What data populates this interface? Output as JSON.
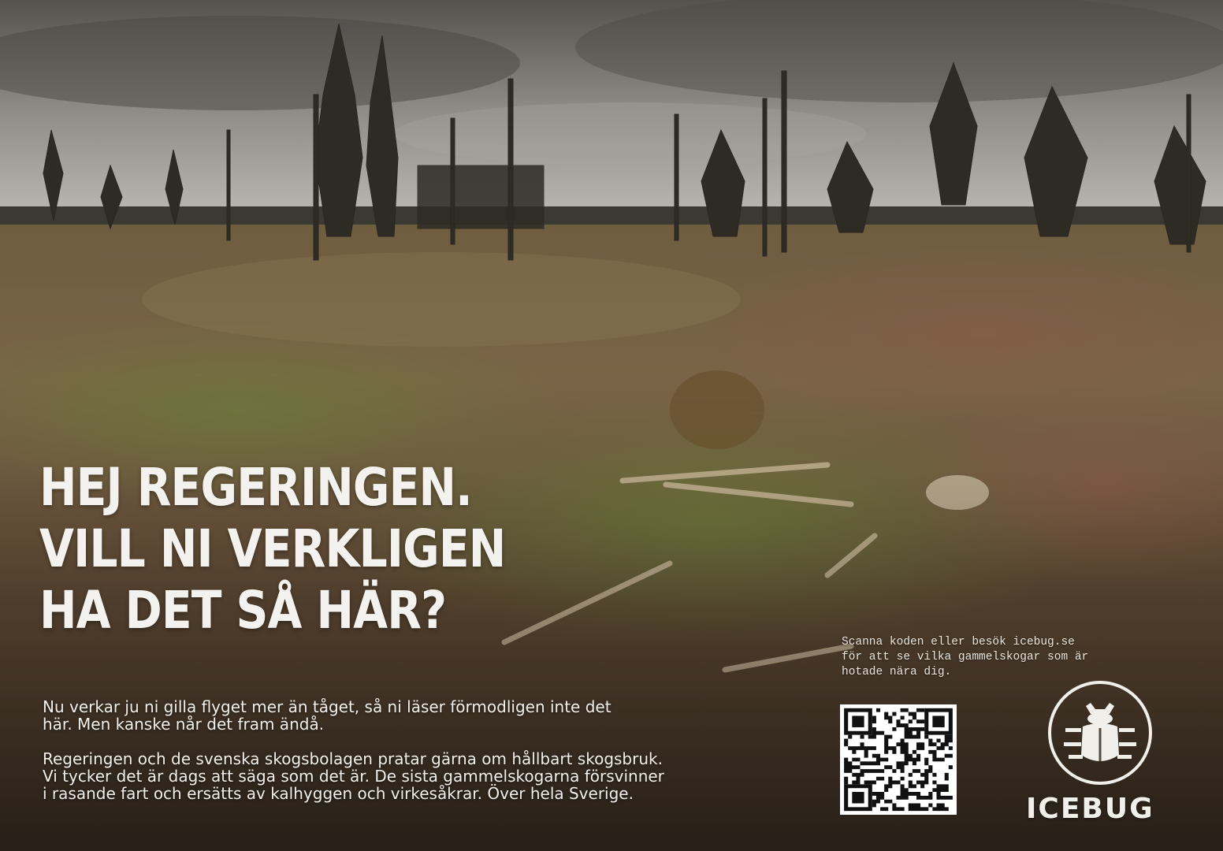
{
  "ad": {
    "headline": [
      "HEJ REGERINGEN.",
      "VILL NI VERKLIGEN",
      "HA DET SÅ HÄR?"
    ],
    "body_paragraphs": [
      "Nu verkar ju ni gilla flyget mer än tåget, så ni läser förmodligen inte det här. Men kanske når det fram ändå.",
      "Regeringen och de svenska skogsbolagen pratar gärna om hållbart skogsbruk. Vi tycker det är dags att säga som det är.  De sista gammelskogarna försvinner i rasande fart och ersätts av kalhyggen och virkesåkrar. Över hela Sverige."
    ],
    "cta_lines": [
      "Scanna koden eller besök icebug.se",
      "för att se vilka gammelskogar som är",
      "hotade nära dig."
    ],
    "brand": "ICEBUG",
    "logo_icon": "beetle-icon",
    "qr_icon": "qr-code-icon"
  },
  "colors": {
    "sky_top": "#6e6b67",
    "sky_horizon": "#b9b6b0",
    "ground_far": "#7a6a4c",
    "ground_near": "#4a3a2a",
    "moss": "#5e6a36",
    "text": "#f4f2ee"
  }
}
